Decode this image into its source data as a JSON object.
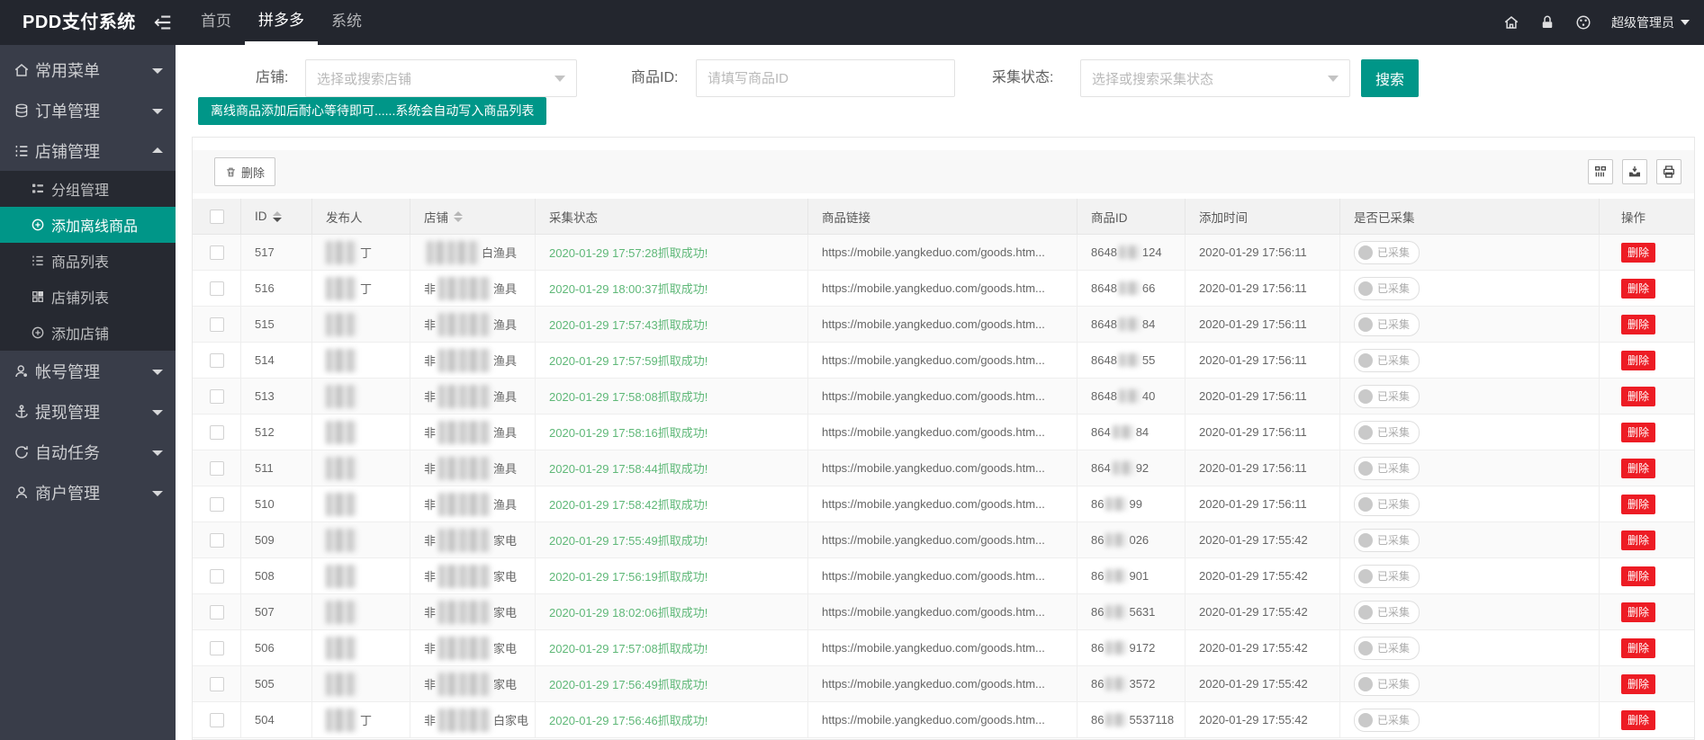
{
  "header": {
    "logo": "PDD支付系统",
    "nav": [
      {
        "label": "首页",
        "active": false
      },
      {
        "label": "拼多多",
        "active": true
      },
      {
        "label": "系统",
        "active": false
      }
    ],
    "user": "超级管理员"
  },
  "sidebar": {
    "items": [
      {
        "label": "常用菜单",
        "icon": "home-icon",
        "expanded": false
      },
      {
        "label": "订单管理",
        "icon": "orders-icon",
        "expanded": false
      },
      {
        "label": "店铺管理",
        "icon": "list-icon",
        "expanded": true,
        "children": [
          {
            "label": "分组管理",
            "icon": "list-grid-icon",
            "active": false
          },
          {
            "label": "添加离线商品",
            "icon": "plus-circle-icon",
            "active": true
          },
          {
            "label": "商品列表",
            "icon": "list-icon",
            "active": false
          },
          {
            "label": "店铺列表",
            "icon": "shop-grid-icon",
            "active": false
          },
          {
            "label": "添加店铺",
            "icon": "plus-circle-icon",
            "active": false
          }
        ]
      },
      {
        "label": "帐号管理",
        "icon": "account-icon",
        "expanded": false
      },
      {
        "label": "提现管理",
        "icon": "withdraw-icon",
        "expanded": false
      },
      {
        "label": "自动任务",
        "icon": "auto-task-icon",
        "expanded": false
      },
      {
        "label": "商户管理",
        "icon": "merchant-icon",
        "expanded": false
      }
    ]
  },
  "filters": {
    "shop_label": "店铺:",
    "shop_placeholder": "选择或搜索店铺",
    "goods_id_label": "商品ID:",
    "goods_id_placeholder": "请填写商品ID",
    "status_label": "采集状态:",
    "status_placeholder": "选择或搜索采集状态",
    "search_button": "搜索",
    "notice": "离线商品添加后耐心等待即可......系统会自动写入商品列表"
  },
  "table": {
    "delete_button": "删除",
    "columns": [
      "ID",
      "发布人",
      "店铺",
      "采集状态",
      "商品链接",
      "商品ID",
      "添加时间",
      "是否已采集",
      "操作"
    ],
    "link_text": "https://mobile.yangkeduo.com/goods.htm...",
    "collected_label": "已采集",
    "row_delete_label": "删除",
    "rows": [
      {
        "id": "517",
        "publisher_hint": "丁",
        "shop_prefix": "",
        "shop_suffix": "白渔具",
        "status": "2020-01-29 17:57:28抓取成功!",
        "goods_id_prefix": "8648",
        "goods_id_suffix": "124",
        "added": "2020-01-29 17:56:11"
      },
      {
        "id": "516",
        "publisher_hint": "丁",
        "shop_prefix": "非",
        "shop_suffix": "渔具",
        "status": "2020-01-29 18:00:37抓取成功!",
        "goods_id_prefix": "8648",
        "goods_id_suffix": "66",
        "added": "2020-01-29 17:56:11"
      },
      {
        "id": "515",
        "publisher_hint": "",
        "shop_prefix": "非",
        "shop_suffix": "渔具",
        "status": "2020-01-29 17:57:43抓取成功!",
        "goods_id_prefix": "8648",
        "goods_id_suffix": "84",
        "added": "2020-01-29 17:56:11"
      },
      {
        "id": "514",
        "publisher_hint": "",
        "shop_prefix": "非",
        "shop_suffix": "渔具",
        "status": "2020-01-29 17:57:59抓取成功!",
        "goods_id_prefix": "8648",
        "goods_id_suffix": "55",
        "added": "2020-01-29 17:56:11"
      },
      {
        "id": "513",
        "publisher_hint": "",
        "shop_prefix": "非",
        "shop_suffix": "渔具",
        "status": "2020-01-29 17:58:08抓取成功!",
        "goods_id_prefix": "8648",
        "goods_id_suffix": "40",
        "added": "2020-01-29 17:56:11"
      },
      {
        "id": "512",
        "publisher_hint": "",
        "shop_prefix": "非",
        "shop_suffix": "渔具",
        "status": "2020-01-29 17:58:16抓取成功!",
        "goods_id_prefix": "864",
        "goods_id_suffix": "84",
        "added": "2020-01-29 17:56:11"
      },
      {
        "id": "511",
        "publisher_hint": "",
        "shop_prefix": "非",
        "shop_suffix": "渔具",
        "status": "2020-01-29 17:58:44抓取成功!",
        "goods_id_prefix": "864",
        "goods_id_suffix": "92",
        "added": "2020-01-29 17:56:11"
      },
      {
        "id": "510",
        "publisher_hint": "",
        "shop_prefix": "非",
        "shop_suffix": "渔具",
        "status": "2020-01-29 17:58:42抓取成功!",
        "goods_id_prefix": "86",
        "goods_id_suffix": "99",
        "added": "2020-01-29 17:56:11"
      },
      {
        "id": "509",
        "publisher_hint": "",
        "shop_prefix": "非",
        "shop_suffix": "家电",
        "status": "2020-01-29 17:55:49抓取成功!",
        "goods_id_prefix": "86",
        "goods_id_suffix": "026",
        "added": "2020-01-29 17:55:42"
      },
      {
        "id": "508",
        "publisher_hint": "",
        "shop_prefix": "非",
        "shop_suffix": "家电",
        "status": "2020-01-29 17:56:19抓取成功!",
        "goods_id_prefix": "86",
        "goods_id_suffix": "901",
        "added": "2020-01-29 17:55:42"
      },
      {
        "id": "507",
        "publisher_hint": "",
        "shop_prefix": "非",
        "shop_suffix": "家电",
        "status": "2020-01-29 18:02:06抓取成功!",
        "goods_id_prefix": "86",
        "goods_id_suffix": "5631",
        "added": "2020-01-29 17:55:42"
      },
      {
        "id": "506",
        "publisher_hint": "",
        "shop_prefix": "非",
        "shop_suffix": "家电",
        "status": "2020-01-29 17:57:08抓取成功!",
        "goods_id_prefix": "86",
        "goods_id_suffix": "9172",
        "added": "2020-01-29 17:55:42"
      },
      {
        "id": "505",
        "publisher_hint": "",
        "shop_prefix": "非",
        "shop_suffix": "家电",
        "status": "2020-01-29 17:56:49抓取成功!",
        "goods_id_prefix": "86",
        "goods_id_suffix": "3572",
        "added": "2020-01-29 17:55:42"
      },
      {
        "id": "504",
        "publisher_hint": "丁",
        "shop_prefix": "非",
        "shop_suffix": "白家电",
        "status": "2020-01-29 17:56:46抓取成功!",
        "goods_id_prefix": "86",
        "goods_id_suffix": "5537118",
        "added": "2020-01-29 17:55:42"
      }
    ]
  },
  "colors": {
    "accent_green": "#009688",
    "status_green": "#5FB878",
    "danger_red": "#ed1c24",
    "header_bg": "#23262E",
    "sidebar_bg": "#393D49"
  }
}
